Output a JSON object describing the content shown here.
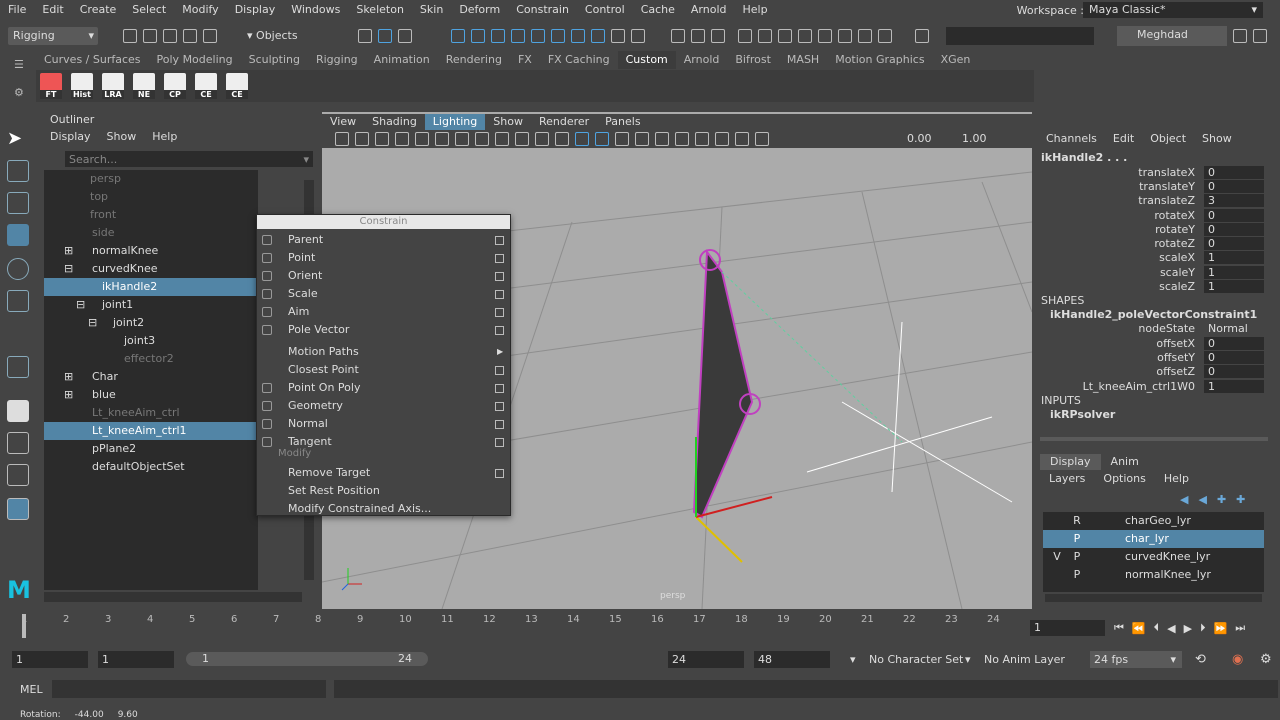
{
  "menubar": [
    "File",
    "Edit",
    "Create",
    "Select",
    "Modify",
    "Display",
    "Windows",
    "Skeleton",
    "Skin",
    "Deform",
    "Constrain",
    "Control",
    "Cache",
    "Arnold",
    "Help"
  ],
  "workspace": {
    "label": "Workspace :",
    "value": "Maya Classic*"
  },
  "status": {
    "menuset": "Rigging",
    "selection_mode": "Objects",
    "user": "Meghdad"
  },
  "shelf": {
    "tabs": [
      "Curves / Surfaces",
      "Poly Modeling",
      "Sculpting",
      "Rigging",
      "Animation",
      "Rendering",
      "FX",
      "FX Caching",
      "Custom",
      "Arnold",
      "Bifrost",
      "MASH",
      "Motion Graphics",
      "XGen"
    ],
    "active_tab": "Custom",
    "buttons": [
      "FT",
      "Hist",
      "LRA",
      "NE",
      "CP",
      "CE",
      "CE"
    ]
  },
  "outliner": {
    "title": "Outliner",
    "menu": [
      "Display",
      "Show",
      "Help"
    ],
    "search_placeholder": "Search...",
    "items": [
      "persp",
      "top",
      "front",
      "side",
      "normalKnee",
      "curvedKnee",
      "ikHandle2",
      "joint1",
      "joint2",
      "joint3",
      "effector2",
      "Char",
      "blue",
      "Lt_kneeAim_ctrl",
      "Lt_kneeAim_ctrl1",
      "pPlane2",
      "defaultObjectSet"
    ]
  },
  "viewport": {
    "menu": [
      "View",
      "Shading",
      "Lighting",
      "Show",
      "Renderer",
      "Panels"
    ],
    "active_menu": "Lighting",
    "gamma": "0.00",
    "exposure": "1.00",
    "camera_label": "persp"
  },
  "constrain_menu": {
    "title": "Constrain",
    "items": [
      "Parent",
      "Point",
      "Orient",
      "Scale",
      "Aim",
      "Pole Vector",
      "Motion Paths",
      "Closest Point",
      "Point On Poly",
      "Geometry",
      "Normal",
      "Tangent"
    ],
    "modify_header": "Modify",
    "modify_items": [
      "Remove Target",
      "Set Rest Position",
      "Modify Constrained Axis..."
    ]
  },
  "channel_box": {
    "menu": [
      "Channels",
      "Edit",
      "Object",
      "Show"
    ],
    "object_name": "ikHandle2 . . .",
    "attrs": [
      {
        "name": "translateX",
        "value": "0"
      },
      {
        "name": "translateY",
        "value": "0"
      },
      {
        "name": "translateZ",
        "value": "3"
      },
      {
        "name": "rotateX",
        "value": "0"
      },
      {
        "name": "rotateY",
        "value": "0"
      },
      {
        "name": "rotateZ",
        "value": "0"
      },
      {
        "name": "scaleX",
        "value": "1"
      },
      {
        "name": "scaleY",
        "value": "1"
      },
      {
        "name": "scaleZ",
        "value": "1"
      }
    ],
    "shapes_header": "SHAPES",
    "shape_name": "ikHandle2_poleVectorConstraint1",
    "shape_attrs": [
      {
        "name": "nodeState",
        "value": "Normal"
      },
      {
        "name": "offsetX",
        "value": "0"
      },
      {
        "name": "offsetY",
        "value": "0"
      },
      {
        "name": "offsetZ",
        "value": "0"
      },
      {
        "name": "Lt_kneeAim_ctrl1W0",
        "value": "1"
      }
    ],
    "inputs_header": "INPUTS",
    "input_name": "ikRPsolver"
  },
  "layer_editor": {
    "tabs": [
      "Display",
      "Anim"
    ],
    "menu": [
      "Layers",
      "Options",
      "Help"
    ],
    "layers": [
      {
        "v": "",
        "p": "R",
        "name": "charGeo_lyr"
      },
      {
        "v": "",
        "p": "P",
        "name": "char_lyr"
      },
      {
        "v": "V",
        "p": "P",
        "name": "curvedKnee_lyr"
      },
      {
        "v": "",
        "p": "P",
        "name": "normalKnee_lyr"
      }
    ]
  },
  "timeline": {
    "ticks": [
      "1",
      "2",
      "3",
      "4",
      "5",
      "6",
      "7",
      "8",
      "9",
      "10",
      "11",
      "12",
      "13",
      "14",
      "15",
      "16",
      "17",
      "18",
      "19",
      "20",
      "21",
      "22",
      "23",
      "24"
    ],
    "current_frame": "1"
  },
  "range": {
    "start": "1",
    "inner_start": "1",
    "range_start": "1",
    "range_end": "24",
    "end": "24",
    "outer_end": "48",
    "character_set": "No Character Set",
    "anim_layer": "No Anim Layer",
    "fps": "24 fps"
  },
  "command": {
    "label": "MEL"
  },
  "help_line": {
    "label": "Rotation:",
    "x": "-44.00",
    "y": "9.60"
  }
}
